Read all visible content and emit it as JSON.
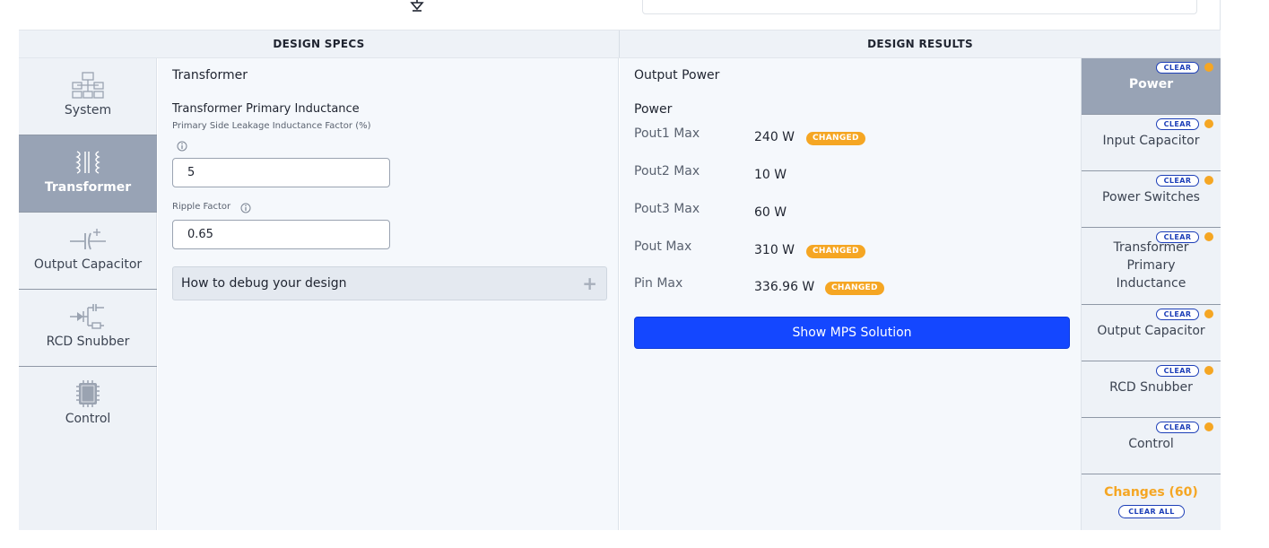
{
  "header": {
    "design_specs": "DESIGN SPECS",
    "design_results": "DESIGN RESULTS"
  },
  "left_nav": {
    "items": [
      {
        "label": "System",
        "icon": "system-icon"
      },
      {
        "label": "Transformer",
        "icon": "transformer-icon",
        "active": true
      },
      {
        "label": "Output Capacitor",
        "icon": "capacitor-icon"
      },
      {
        "label": "RCD Snubber",
        "icon": "snubber-icon"
      },
      {
        "label": "Control",
        "icon": "chip-icon"
      }
    ]
  },
  "spec": {
    "section_title": "Transformer",
    "subsection_title": "Transformer Primary Inductance",
    "leakage_label": "Primary Side Leakage Inductance Factor (%)",
    "leakage_value": "5",
    "ripple_label": "Ripple Factor",
    "ripple_value": "0.65",
    "debug_label": "How to debug your design",
    "debug_plus": "+"
  },
  "results": {
    "section_title": "Output Power",
    "group_title": "Power",
    "rows": [
      {
        "label": "Pout1 Max",
        "value": "240 W",
        "badge": "CHANGED"
      },
      {
        "label": "Pout2 Max",
        "value": "10 W",
        "badge": ""
      },
      {
        "label": "Pout3 Max",
        "value": "60 W",
        "badge": ""
      },
      {
        "label": "Pout Max",
        "value": "310 W",
        "badge": "CHANGED"
      },
      {
        "label": "Pin Max",
        "value": "336.96 W",
        "badge": "CHANGED"
      }
    ],
    "mps_button": "Show MPS Solution"
  },
  "right_nav": {
    "clear_label": "CLEAR",
    "items": [
      {
        "label": "Power",
        "active": true
      },
      {
        "label": "Input Capacitor"
      },
      {
        "label": "Power Switches"
      },
      {
        "label": "Transformer Primary Inductance"
      },
      {
        "label": "Output Capacitor"
      },
      {
        "label": "RCD Snubber"
      },
      {
        "label": "Control"
      }
    ],
    "changes_label": "Changes (60)",
    "clear_all_label": "CLEAR ALL"
  },
  "colors": {
    "accent_blue": "#1447ff",
    "badge_orange": "#f5a623",
    "nav_active": "#98a3b5"
  }
}
